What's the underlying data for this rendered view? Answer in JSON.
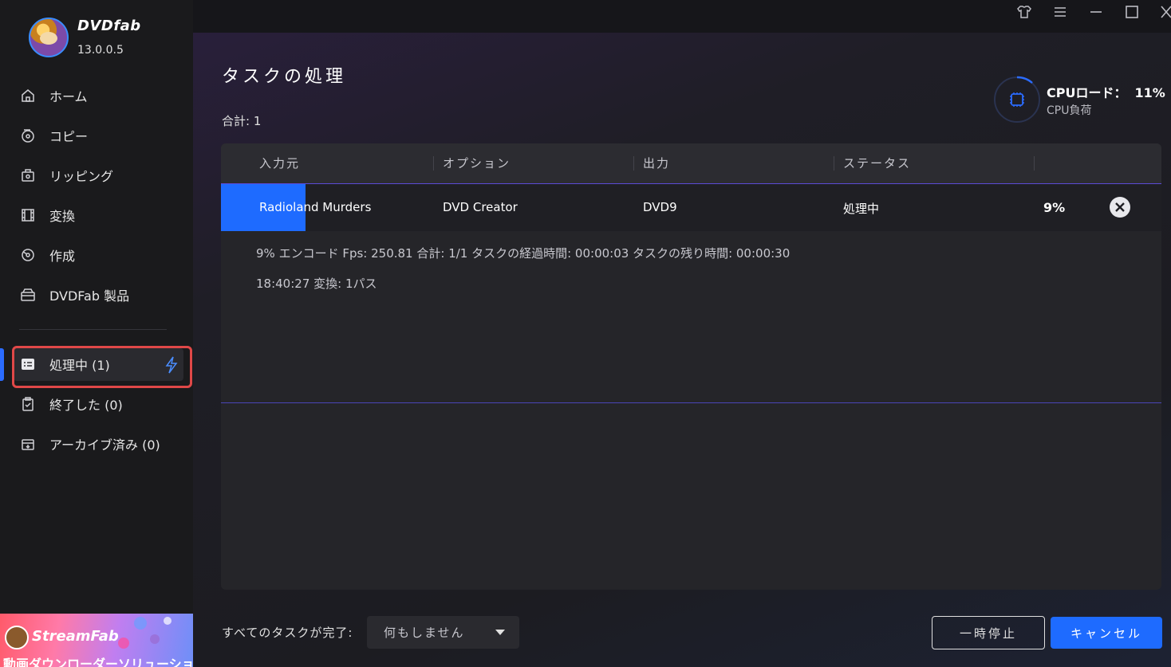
{
  "app": {
    "brand": "DVDfab",
    "version": "13.0.0.5"
  },
  "sidebar": {
    "items": [
      {
        "label": "ホーム",
        "icon": "home-icon"
      },
      {
        "label": "コピー",
        "icon": "copy-disc-icon"
      },
      {
        "label": "リッピング",
        "icon": "ripping-icon"
      },
      {
        "label": "変換",
        "icon": "film-icon"
      },
      {
        "label": "作成",
        "icon": "create-disc-icon"
      },
      {
        "label": "DVDFab 製品",
        "icon": "products-icon"
      }
    ],
    "tasks": [
      {
        "label": "処理中 (1)",
        "icon": "processing-list-icon",
        "active": true
      },
      {
        "label": "終了した (0)",
        "icon": "clipboard-check-icon"
      },
      {
        "label": "アーカイブ済み (0)",
        "icon": "archive-icon"
      }
    ],
    "promo": {
      "brand": "StreamFab",
      "subtitle": "動画ダウンローダーソリューション"
    }
  },
  "header": {
    "title": "タスクの処理",
    "total": "合計: 1",
    "cpu": {
      "label": "CPUロード：",
      "value": "11%",
      "sub": "CPU負荷"
    }
  },
  "table": {
    "headers": [
      "入力元",
      "オプション",
      "出力",
      "ステータス"
    ],
    "row": {
      "source": "Radioland Murders",
      "option": "DVD Creator",
      "output": "DVD9",
      "status": "処理中",
      "progress_label": "9%",
      "progress": 0.09
    },
    "detail": {
      "line1": "9%  エンコード Fps: 250.81   合計: 1/1  タスクの経過時間: 00:00:03  タスクの残り時間: 00:00:30",
      "line2": "18:40:27  変換: 1パス"
    }
  },
  "footer": {
    "after_label": "すべてのタスクが完了:",
    "after_value": "何もしません",
    "pause": "一時停止",
    "cancel": "キャンセル"
  },
  "colors": {
    "accent": "#1e6bff",
    "highlight": "#e04848"
  }
}
